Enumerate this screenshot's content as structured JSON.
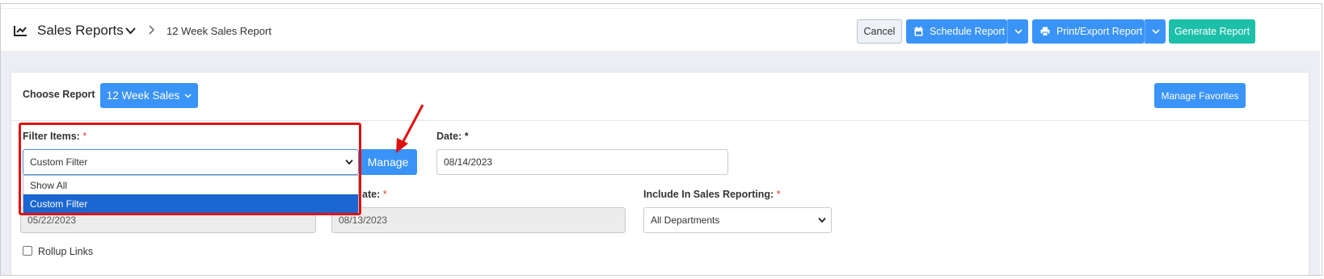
{
  "header": {
    "title": "Sales Reports",
    "breadcrumb": "12 Week Sales Report"
  },
  "toolbar": {
    "cancel_label": "Cancel",
    "schedule_label": "Schedule Report",
    "print_label": "Print/Export Report",
    "generate_label": "Generate Report"
  },
  "report": {
    "choose_label": "Choose Report",
    "selected_report": "12 Week Sales",
    "favorites_label": "Manage Favorites"
  },
  "filters": {
    "filter_items_label": "Filter Items:",
    "filter_items_value": "Custom Filter",
    "filter_options": [
      "Show All",
      "Custom Filter"
    ],
    "selected_option_index": 1,
    "manage_label": "Manage",
    "date_label": "Date:",
    "date_value": "08/14/2023",
    "start_date_value": "05/22/2023",
    "end_date_label_partial": "ate:",
    "end_date_value": "08/13/2023",
    "include_label": "Include In Sales Reporting:",
    "include_value": "All Departments",
    "rollup_label": "Rollup Links",
    "rollup_checked": false,
    "required_mark": "*"
  },
  "colors": {
    "primary": "#3a93f7",
    "success": "#1cbfa8",
    "highlight": "#e01010",
    "selected_option": "#1a66d2"
  }
}
